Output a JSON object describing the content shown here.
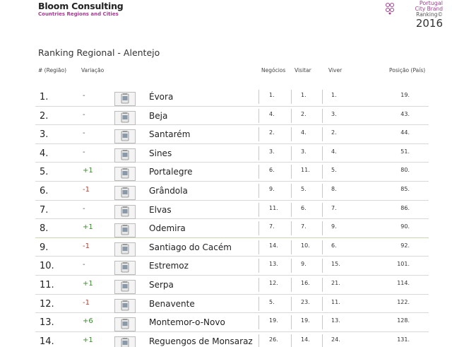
{
  "header": {
    "brand_name": "Bloom Consulting",
    "brand_subtitle": "Countries Regions and Cities",
    "ranking_line1": "Portugal",
    "ranking_line2": "City Brand",
    "ranking_line3": "Ranking©",
    "ranking_year": "2016",
    "accent_color": "#a23d8f"
  },
  "page_title": "Ranking Regional - Alentejo",
  "columns": {
    "rank": "# (Região)",
    "variation": "Variação",
    "business": "Negócios",
    "visit": "Visitar",
    "live": "Viver",
    "country_position": "Posição (País)"
  },
  "rows": [
    {
      "rank": "1.",
      "variation": "-",
      "city": "Évora",
      "business": "1.",
      "visit": "1.",
      "live": "1.",
      "country": "19."
    },
    {
      "rank": "2.",
      "variation": "-",
      "city": "Beja",
      "business": "4.",
      "visit": "2.",
      "live": "3.",
      "country": "43."
    },
    {
      "rank": "3.",
      "variation": "-",
      "city": "Santarém",
      "business": "2.",
      "visit": "4.",
      "live": "2.",
      "country": "44."
    },
    {
      "rank": "4.",
      "variation": "-",
      "city": "Sines",
      "business": "3.",
      "visit": "3.",
      "live": "4.",
      "country": "51."
    },
    {
      "rank": "5.",
      "variation": "+1",
      "city": "Portalegre",
      "business": "6.",
      "visit": "11.",
      "live": "5.",
      "country": "80."
    },
    {
      "rank": "6.",
      "variation": "-1",
      "city": "Grândola",
      "business": "9.",
      "visit": "5.",
      "live": "8.",
      "country": "85."
    },
    {
      "rank": "7.",
      "variation": "-",
      "city": "Elvas",
      "business": "11.",
      "visit": "6.",
      "live": "7.",
      "country": "86."
    },
    {
      "rank": "8.",
      "variation": "+1",
      "city": "Odemira",
      "business": "7.",
      "visit": "7.",
      "live": "9.",
      "country": "90."
    },
    {
      "rank": "9.",
      "variation": "-1",
      "city": "Santiago do Cacém",
      "business": "14.",
      "visit": "10.",
      "live": "6.",
      "country": "92."
    },
    {
      "rank": "10.",
      "variation": "-",
      "city": "Estremoz",
      "business": "13.",
      "visit": "9.",
      "live": "15.",
      "country": "101."
    },
    {
      "rank": "11.",
      "variation": "+1",
      "city": "Serpa",
      "business": "12.",
      "visit": "16.",
      "live": "21.",
      "country": "114."
    },
    {
      "rank": "12.",
      "variation": "-1",
      "city": "Benavente",
      "business": "5.",
      "visit": "23.",
      "live": "11.",
      "country": "122."
    },
    {
      "rank": "13.",
      "variation": "+6",
      "city": "Montemor-o-Novo",
      "business": "19.",
      "visit": "19.",
      "live": "13.",
      "country": "128."
    },
    {
      "rank": "14.",
      "variation": "+1",
      "city": "Reguengos de Monsaraz",
      "business": "26.",
      "visit": "14.",
      "live": "24.",
      "country": "131."
    }
  ]
}
